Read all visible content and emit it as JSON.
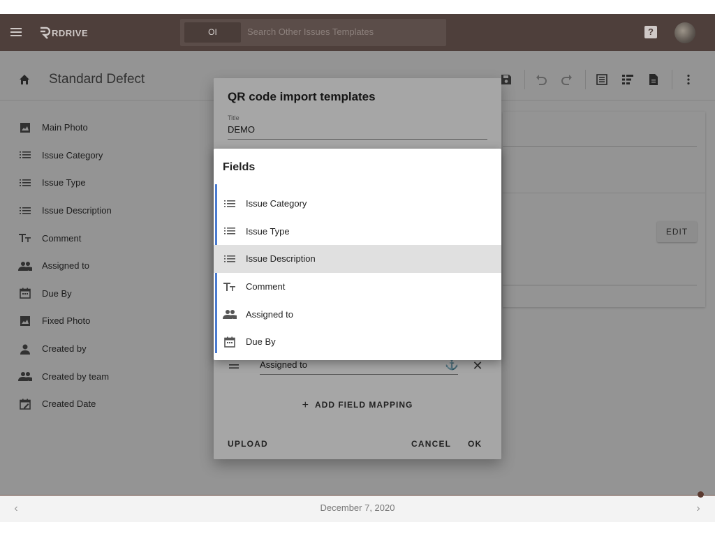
{
  "app": {
    "logo_text": "RDRIVE",
    "search_chip": "OI",
    "search_placeholder": "Search Other Issues Templates"
  },
  "page": {
    "title": "Standard Defect",
    "edit_label": "EDIT"
  },
  "sidebar": {
    "items": [
      {
        "label": "Main Photo",
        "icon": "image-icon"
      },
      {
        "label": "Issue Category",
        "icon": "list-icon"
      },
      {
        "label": "Issue Type",
        "icon": "list-icon"
      },
      {
        "label": "Issue Description",
        "icon": "list-icon"
      },
      {
        "label": "Comment",
        "icon": "text-icon"
      },
      {
        "label": "Assigned to",
        "icon": "people-icon"
      },
      {
        "label": "Due By",
        "icon": "calendar-icon"
      },
      {
        "label": "Fixed Photo",
        "icon": "image-icon"
      },
      {
        "label": "Created by",
        "icon": "person-icon"
      },
      {
        "label": "Created by team",
        "icon": "people-icon"
      },
      {
        "label": "Created Date",
        "icon": "calendar-edit-icon"
      }
    ]
  },
  "dialog": {
    "title": "QR code import templates",
    "title_field_label": "Title",
    "title_field_value": "DEMO",
    "mapping_value": "Assigned to",
    "add_mapping_label": "ADD FIELD MAPPING",
    "upload_label": "UPLOAD",
    "cancel_label": "CANCEL",
    "ok_label": "OK"
  },
  "fields_popup": {
    "title": "Fields",
    "items": [
      {
        "label": "Issue Category",
        "icon": "list-icon",
        "selected": false
      },
      {
        "label": "Issue Type",
        "icon": "list-icon",
        "selected": false
      },
      {
        "label": "Issue Description",
        "icon": "list-icon",
        "selected": true
      },
      {
        "label": "Comment",
        "icon": "text-icon",
        "selected": false
      },
      {
        "label": "Assigned to",
        "icon": "people-icon",
        "selected": false
      },
      {
        "label": "Due By",
        "icon": "calendar-icon",
        "selected": false
      }
    ]
  },
  "footer": {
    "date": "December 7, 2020"
  },
  "colors": {
    "appbar": "#4e3f3b",
    "accent_bar": "#4a7bd0",
    "selected_row": "#e0e0e0",
    "footer_accent": "#5b3a30"
  }
}
